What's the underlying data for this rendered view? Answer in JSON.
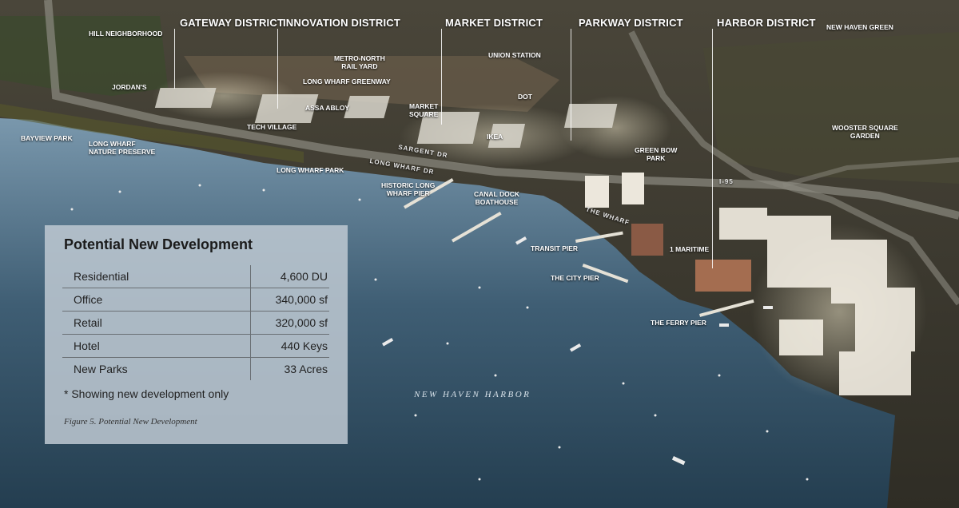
{
  "districts": {
    "gateway": "GATEWAY DISTRICT",
    "innovation": "INNOVATION DISTRICT",
    "market": "MARKET DISTRICT",
    "parkway": "PARKWAY DISTRICT",
    "harbor": "HARBOR DISTRICT"
  },
  "labels": {
    "hill": "HILL NEIGHBORHOOD",
    "new_haven_green": "NEW HAVEN GREEN",
    "metro_north_1": "METRO-NORTH",
    "metro_north_2": "RAIL YARD",
    "union_station": "UNION STATION",
    "jordans": "JORDAN'S",
    "long_wharf_greenway": "LONG WHARF GREENWAY",
    "dot": "DOT",
    "assa_abloy": "ASSA ABLOY",
    "market_square_1": "MARKET",
    "market_square_2": "SQUARE",
    "tech_village": "TECH VILLAGE",
    "ikea": "IKEA",
    "bayview_park": "BAYVIEW PARK",
    "lw_preserve_1": "LONG WHARF",
    "lw_preserve_2": "NATURE PRESERVE",
    "long_wharf_park": "LONG WHARF PARK",
    "historic_pier_1": "HISTORIC LONG",
    "historic_pier_2": "WHARF PIER",
    "canal_dock_1": "CANAL DOCK",
    "canal_dock_2": "BOATHOUSE",
    "green_bow_1": "GREEN BOW",
    "green_bow_2": "PARK",
    "wooster_1": "WOOSTER SQUARE",
    "wooster_2": "GARDEN",
    "transit_pier": "TRANSIT PIER",
    "one_maritime": "1 MARITIME",
    "city_pier": "THE CITY PIER",
    "ferry_pier": "THE FERRY PIER",
    "new_haven_harbor": "NEW HAVEN HARBOR"
  },
  "streets": {
    "sargent": "SARGENT DR",
    "long_wharf_dr": "LONG WHARF DR",
    "wharf": "THE WHARF",
    "i95": "I-95"
  },
  "legend": {
    "title": "Potential New Development",
    "rows": [
      {
        "label": "Residential",
        "value": "4,600 DU"
      },
      {
        "label": "Office",
        "value": "340,000 sf"
      },
      {
        "label": "Retail",
        "value": "320,000 sf"
      },
      {
        "label": "Hotel",
        "value": "440 Keys"
      },
      {
        "label": "New Parks",
        "value": "33 Acres"
      }
    ],
    "note": "* Showing new development only",
    "figure_caption": "Figure 5.     Potential New Development"
  },
  "colors": {
    "water_dark": "#2b4659",
    "water_light": "#8fa9bb",
    "land": "#3d3a30",
    "development": "#f1ece2",
    "legend_bg": "#bec8d2"
  }
}
